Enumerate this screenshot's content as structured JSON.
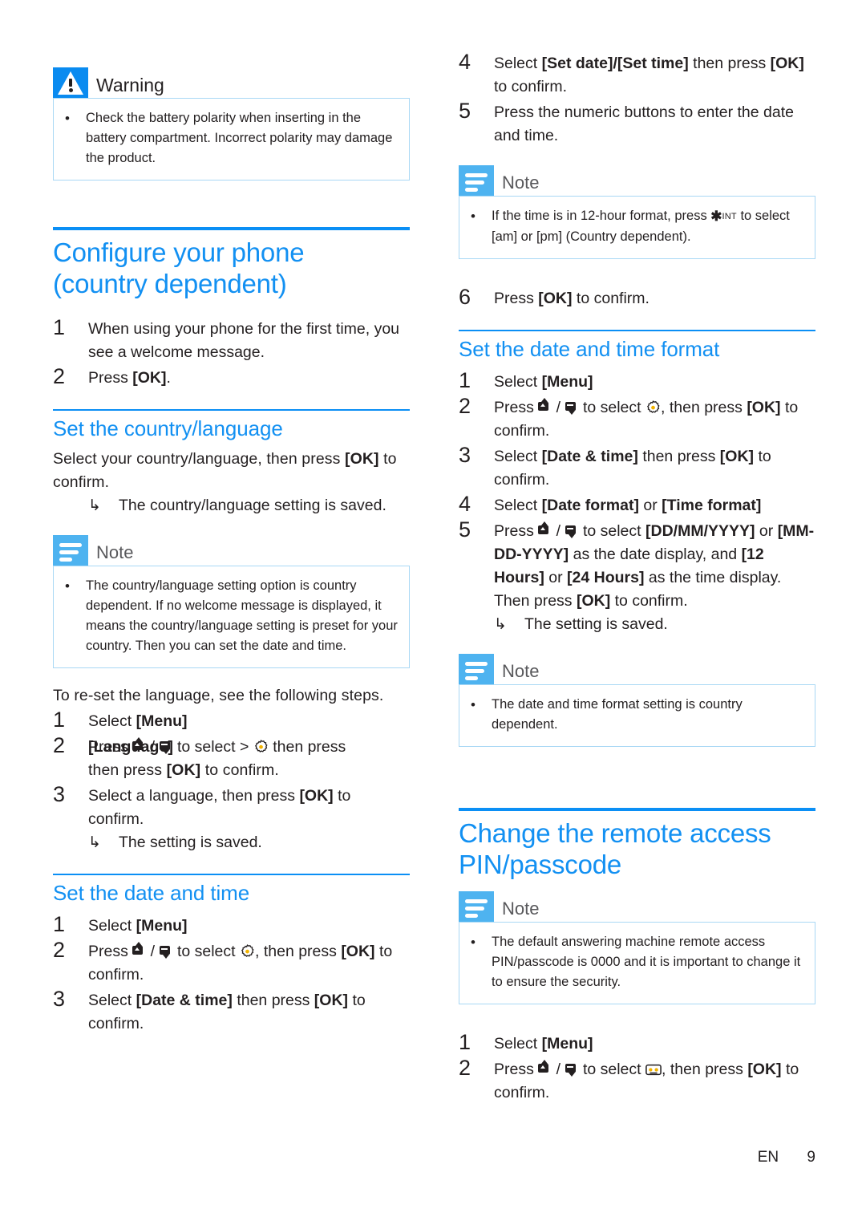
{
  "meta": {
    "accent_blue": "#1290f2",
    "rule_blue": "#0b8ff5",
    "note_badge_blue": "#4eb3f0",
    "warning_badge_blue": "#0a8bf0",
    "gear_accent": "#f2b300"
  },
  "left": {
    "warning": {
      "title": "Warning",
      "icon": "warning-triangle-icon",
      "items": [
        "Check the battery polarity when inserting in the battery compartment. Incorrect polarity may damage the product."
      ]
    },
    "chapter": {
      "line1": "Configure your phone",
      "line2": "(country dependent)"
    },
    "chapter_steps": [
      {
        "num": "1",
        "text": "When using your phone for the first time, you see a welcome message."
      },
      {
        "num": "2",
        "text_pre": "Press ",
        "bold": "[OK]",
        "text_post": "."
      }
    ],
    "section_country": {
      "heading": "Set the country/language",
      "para_pre": "Select your country/language, then press ",
      "para_bold": "[OK]",
      "para_post": " to confirm.",
      "result": "The country/language setting is saved.",
      "note": {
        "title": "Note",
        "items": [
          "The country/language setting option is country dependent. If no welcome message is displayed, it means the country/language setting is preset for your country. Then you can set the date and time."
        ]
      },
      "reset_intro": "To re-set the language, see the following steps.",
      "reset_steps": [
        {
          "num": "1",
          "pre": "Select ",
          "bold": "[Menu]",
          "post": ""
        },
        {
          "num": "2",
          "pre": "Press ",
          "mid": " to select > ",
          "bold2": "[Language]",
          "post": " then press ",
          "bold3": "[OK]",
          "tail": " to confirm."
        },
        {
          "num": "3",
          "pre": "Select a language, then press ",
          "bold": "[OK]",
          "post": " to confirm."
        }
      ],
      "reset_result": "The setting is saved."
    },
    "section_datetime": {
      "heading": "Set the date and time",
      "steps": [
        {
          "num": "1",
          "pre": "Select ",
          "bold": "[Menu]",
          "post": ""
        },
        {
          "num": "2",
          "pre": "Press ",
          "mid": " to select ",
          "post": ", then press ",
          "bold2": "[OK]",
          "tail": " to confirm."
        },
        {
          "num": "3",
          "pre": "Select ",
          "bold": "[Date & time]",
          "post": " then press ",
          "bold2": "[OK]",
          "tail": " to confirm."
        }
      ]
    }
  },
  "right": {
    "datetime_steps_cont": [
      {
        "num": "4",
        "pre": "Select ",
        "bold": "[Set date]/[Set time]",
        "post": " then press ",
        "bold2": "[OK]",
        "tail": " to confirm."
      },
      {
        "num": "5",
        "pre": "Press the numeric buttons to enter the date and time.",
        "bold": "",
        "post": ""
      }
    ],
    "note_12hour": {
      "title": "Note",
      "pre": "If the time is in 12-hour format, press ",
      "star": "✱",
      "int": "INT",
      "mid": " to select ",
      "am": "[am]",
      "or": " or ",
      "pm": "[pm]",
      "post": " (Country dependent)."
    },
    "step6": {
      "num": "6",
      "pre": "Press ",
      "bold": "[OK]",
      "post": " to confirm."
    },
    "section_format": {
      "heading": "Set the date and time format",
      "steps": [
        {
          "num": "1",
          "pre": "Select ",
          "bold": "[Menu]",
          "post": ""
        },
        {
          "num": "2",
          "pre": "Press ",
          "mid": " to select ",
          "post": ", then press ",
          "bold2": "[OK]",
          "tail": " to confirm."
        },
        {
          "num": "3",
          "pre": "Select ",
          "bold": "[Date & time]",
          "post": " then press ",
          "bold2": "[OK]",
          "tail": " to confirm."
        },
        {
          "num": "4",
          "pre": "Select ",
          "bold": "[Date format]",
          "post": " or ",
          "bold2": "[Time format]",
          "tail": ""
        },
        {
          "num": "5",
          "pre": "Press ",
          "mid": " to select ",
          "bold": "[DD/MM/YYYY]",
          "post": " or ",
          "bold2": "[MM-DD-YYYY]",
          "post2": " as the date display, and ",
          "bold3": "[12 Hours]",
          "post3": " or ",
          "bold4": "[24 Hours]",
          "post4": " as the time display. Then press ",
          "bold5": "[OK]",
          "tail": " to confirm."
        }
      ],
      "result": "The setting is saved.",
      "note": {
        "title": "Note",
        "items": [
          "The date and time format setting is country dependent."
        ]
      }
    },
    "chapter_pin": {
      "line1": "Change the remote access",
      "line2": "PIN/passcode",
      "note": {
        "title": "Note",
        "items": [
          "The default answering machine remote access PIN/passcode is 0000 and it is important to change it to ensure the security."
        ]
      },
      "steps": [
        {
          "num": "1",
          "pre": "Select ",
          "bold": "[Menu]",
          "post": ""
        },
        {
          "num": "2",
          "pre": "Press ",
          "mid": " to select ",
          "post": ", then press ",
          "bold2": "[OK]",
          "tail": " to confirm."
        }
      ]
    }
  },
  "footer": {
    "language": "EN",
    "page": "9"
  }
}
